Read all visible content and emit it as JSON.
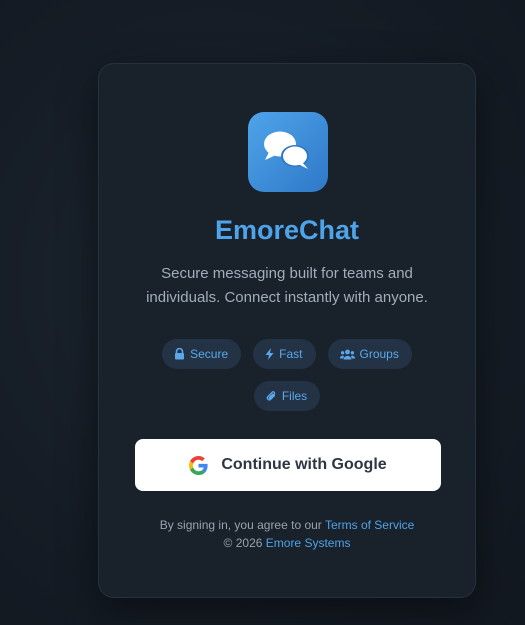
{
  "app": {
    "name": "EmoreChat",
    "tagline": "Secure messaging built for teams and individuals. Connect instantly with anyone.",
    "icon": "chat-bubbles-icon"
  },
  "features": [
    {
      "label": "Secure",
      "icon": "lock-icon"
    },
    {
      "label": "Fast",
      "icon": "bolt-icon"
    },
    {
      "label": "Groups",
      "icon": "users-icon"
    },
    {
      "label": "Files",
      "icon": "paperclip-icon"
    }
  ],
  "login": {
    "google_button_label": "Continue with Google",
    "google_icon": "google-logo-icon"
  },
  "footer": {
    "agree_text": "By signing in, you agree to our",
    "terms_link": "Terms of Service",
    "copyright": "© 2026",
    "company_link": "Emore Systems"
  },
  "colors": {
    "background": "#151c25",
    "card": "#19212b",
    "accent": "#4fa3e8",
    "chip_bg": "#233244",
    "button_bg": "#ffffff",
    "button_text": "#2d3642",
    "muted_text": "#a2adbb"
  }
}
